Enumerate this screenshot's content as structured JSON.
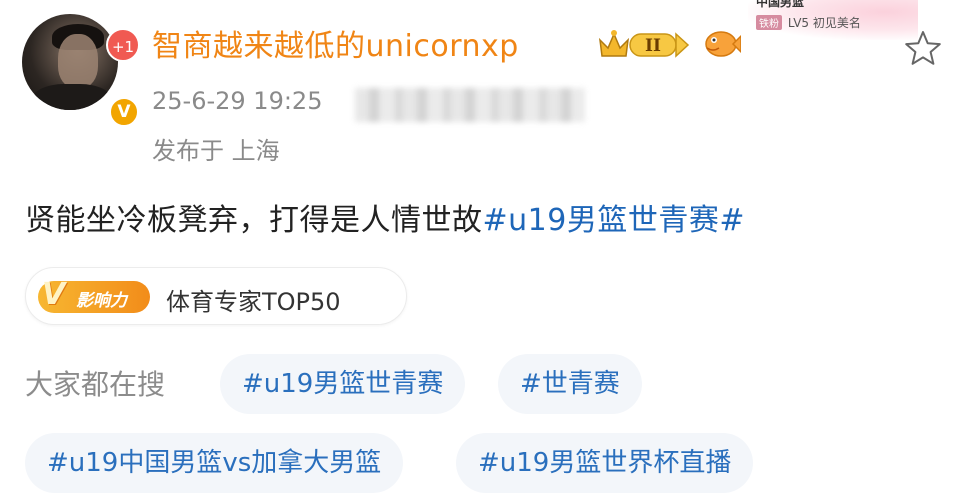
{
  "user": {
    "name": "智商越来越低的unicornxp",
    "plus_badge": "+1",
    "verified_mark": "V",
    "rank": "II"
  },
  "corner": {
    "top_text": "中国男篮",
    "level_tag": "铁粉",
    "level_text": "LV5 初见美名"
  },
  "post": {
    "time": "25-6-29 19:25",
    "location": "发布于 上海",
    "text_plain": "贤能坐冷板凳弃，打得是人情世故",
    "text_hashtag": "#u19男篮世青赛#"
  },
  "influence": {
    "logo_text": "影响力",
    "logo_v": "V",
    "label": "体育专家TOP50"
  },
  "trending": {
    "label": "大家都在搜",
    "chips": [
      "#u19男篮世青赛",
      "#世青赛",
      "#u19中国男篮vs加拿大男篮",
      "#u19男篮世界杯直播"
    ]
  },
  "icons": {
    "rank": "crown-rank-icon",
    "fish": "fish-icon",
    "star": "star-icon"
  },
  "colors": {
    "username": "#f08515",
    "hashtag": "#1e66b8",
    "muted": "#8a8a8a",
    "chip_bg": "#f3f6fa"
  }
}
